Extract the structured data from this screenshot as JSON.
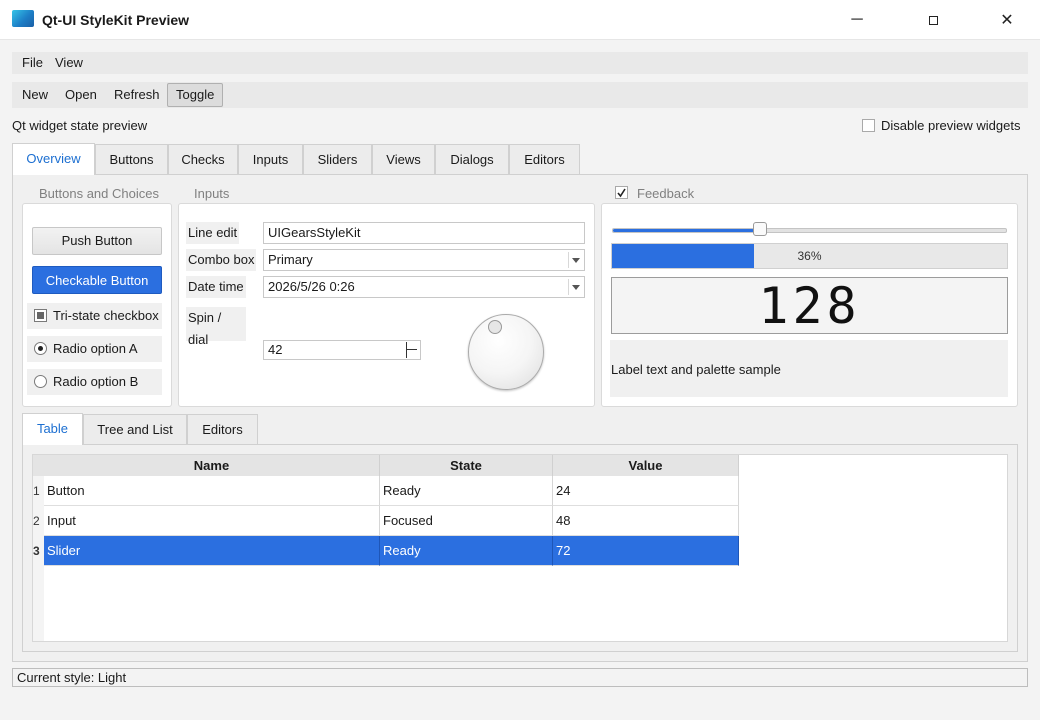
{
  "window": {
    "title": "Qt-UI StyleKit Preview"
  },
  "menu": [
    "File",
    "View"
  ],
  "toolbar": [
    "New",
    "Open",
    "Refresh",
    "Toggle"
  ],
  "preview_label": "Qt widget state preview",
  "disable_label": "Disable preview widgets",
  "tabs": [
    "Overview",
    "Buttons",
    "Checks",
    "Inputs",
    "Sliders",
    "Views",
    "Dialogs",
    "Editors"
  ],
  "groups": {
    "buttons": {
      "title": "Buttons and Choices",
      "push": "Push Button",
      "checkable": "Checkable Button",
      "tristate": "Tri-state checkbox",
      "radio_a": "Radio option A",
      "radio_b": "Radio option B"
    },
    "inputs": {
      "title": "Inputs",
      "line_edit_label": "Line edit",
      "line_edit_value": "UIGearsStyleKit",
      "combo_label": "Combo box",
      "combo_value": "Primary",
      "date_label": "Date time",
      "date_value": "2026/5/26 0:26",
      "spin_label": "Spin / dial",
      "spin_value": "42"
    },
    "feedback": {
      "title": "Feedback",
      "checked": true,
      "slider_fraction": 0.36,
      "progress_fraction": 0.36,
      "progress_text": "36%",
      "lcd_value": "128",
      "palette_label": "Label text and palette sample"
    }
  },
  "subtabs": [
    "Table",
    "Tree and List",
    "Editors"
  ],
  "table": {
    "headers": [
      "Name",
      "State",
      "Value"
    ],
    "rows": [
      {
        "num": "1",
        "name": "Button",
        "state": "Ready",
        "value": "24"
      },
      {
        "num": "2",
        "name": "Input",
        "state": "Focused",
        "value": "48"
      },
      {
        "num": "3",
        "name": "Slider",
        "state": "Ready",
        "value": "72"
      }
    ],
    "selected_row": 2
  },
  "status": "Current style: Light",
  "colors": {
    "accent": "#2b6fe0",
    "tab_selected_text": "#1c6fd1"
  }
}
